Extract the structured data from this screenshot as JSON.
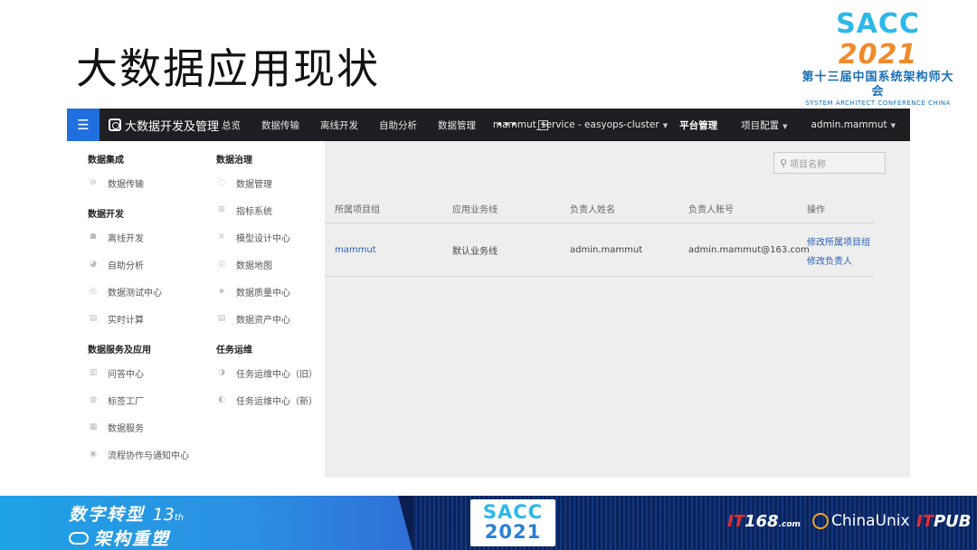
{
  "slide": {
    "title": "大数据应用现状",
    "logo": {
      "sacc": "SACC",
      "year": "2021",
      "cn_line": "第十三届中国系统架构师大会",
      "en_line": "SYSTEM ARCHITECT CONFERENCE CHINA 2021"
    }
  },
  "app": {
    "brand": "大数据开发及管理",
    "nav": [
      "总览",
      "数据传输",
      "离线开发",
      "自助分析",
      "数据管理"
    ],
    "nav_more": "•••",
    "cluster": "mammut_service - easyops-cluster",
    "platform": "平台管理",
    "project_config": "项目配置",
    "user": "admin.mammut"
  },
  "menu": {
    "col1": [
      {
        "title": "数据集成",
        "items": [
          {
            "label": "数据传输",
            "icon": "transfer-icon"
          }
        ]
      },
      {
        "title": "数据开发",
        "items": [
          {
            "label": "离线开发",
            "icon": "workflow-icon"
          },
          {
            "label": "自助分析",
            "icon": "pie-icon"
          },
          {
            "label": "数据测试中心",
            "icon": "test-icon"
          },
          {
            "label": "实时计算",
            "icon": "realtime-icon"
          }
        ]
      },
      {
        "title": "数据服务及应用",
        "items": [
          {
            "label": "问答中心",
            "icon": "qa-icon"
          },
          {
            "label": "标签工厂",
            "icon": "tag-icon"
          },
          {
            "label": "数据服务",
            "icon": "service-icon"
          },
          {
            "label": "流程协作与通知中心",
            "icon": "flow-icon"
          }
        ]
      }
    ],
    "col2": [
      {
        "title": "数据治理",
        "items": [
          {
            "label": "数据管理",
            "icon": "manage-icon"
          },
          {
            "label": "指标系统",
            "icon": "metric-icon"
          },
          {
            "label": "模型设计中心",
            "icon": "model-icon"
          },
          {
            "label": "数据地图",
            "icon": "map-icon"
          },
          {
            "label": "数据质量中心",
            "icon": "quality-icon"
          },
          {
            "label": "数据资产中心",
            "icon": "asset-icon"
          }
        ]
      },
      {
        "title": "任务运维",
        "items": [
          {
            "label": "任务运维中心（旧）",
            "icon": "ops-old-icon"
          },
          {
            "label": "任务运维中心（新）",
            "icon": "ops-new-icon"
          }
        ]
      }
    ]
  },
  "search": {
    "placeholder": "项目名称"
  },
  "table": {
    "headers": [
      "所属项目组",
      "应用业务线",
      "负责人姓名",
      "负责人账号",
      "操作"
    ],
    "row": {
      "group": "mammut",
      "business": "默认业务线",
      "owner_name": "admin.mammut",
      "owner_account": "admin.mammut@163.com",
      "op1": "修改所属项目组",
      "op2": "修改负责人"
    }
  },
  "banner": {
    "line1": "数字转型",
    "edition": "13",
    "edition_suffix": "th",
    "line2": "架构重塑",
    "center_top": "SACC",
    "center_bottom": "2021",
    "sponsor1_a": "IT",
    "sponsor1_b": "168",
    "sponsor1_c": ".com",
    "sponsor2": "ChinaUnix",
    "sponsor3_a": "IT",
    "sponsor3_b": "PUB"
  },
  "colors": {
    "accent": "#1f6fde",
    "topbar": "#1e1f22",
    "link": "#2a5fb8",
    "banner": "#0a1e4f"
  }
}
